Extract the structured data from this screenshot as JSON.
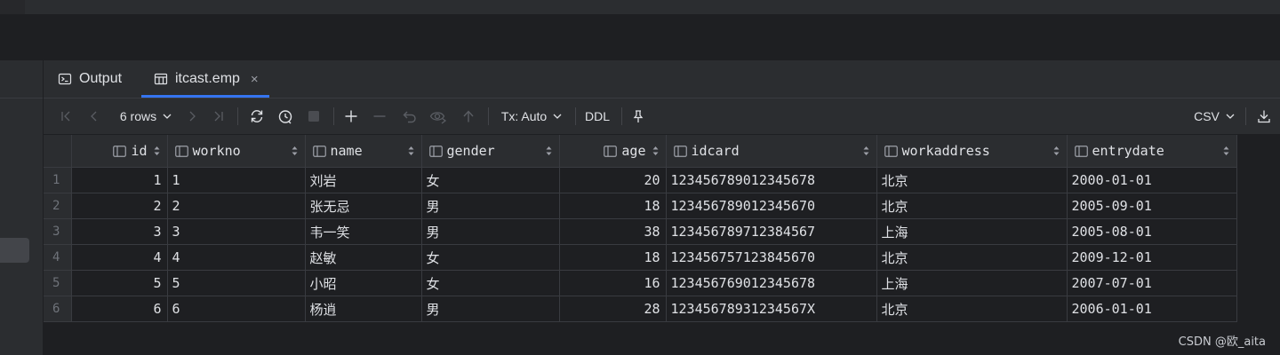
{
  "tabs": [
    {
      "label": "Output",
      "icon": "console-icon"
    },
    {
      "label": "itcast.emp",
      "icon": "table-icon",
      "close": "×"
    }
  ],
  "toolbar": {
    "rows_label": "6 rows",
    "tx_label": "Tx: Auto",
    "ddl_label": "DDL",
    "export_label": "CSV"
  },
  "grid": {
    "columns": [
      {
        "name": "id",
        "align": "right"
      },
      {
        "name": "workno",
        "align": "left"
      },
      {
        "name": "name",
        "align": "left"
      },
      {
        "name": "gender",
        "align": "left"
      },
      {
        "name": "age",
        "align": "right"
      },
      {
        "name": "idcard",
        "align": "left"
      },
      {
        "name": "workaddress",
        "align": "left"
      },
      {
        "name": "entrydate",
        "align": "left"
      }
    ],
    "rows": [
      {
        "n": "1",
        "cells": [
          "1",
          "1",
          "刘岩",
          "女",
          "20",
          "123456789012345678",
          "北京",
          "2000-01-01"
        ]
      },
      {
        "n": "2",
        "cells": [
          "2",
          "2",
          "张无忌",
          "男",
          "18",
          "123456789012345670",
          "北京",
          "2005-09-01"
        ]
      },
      {
        "n": "3",
        "cells": [
          "3",
          "3",
          "韦一笑",
          "男",
          "38",
          "123456789712384567",
          "上海",
          "2005-08-01"
        ]
      },
      {
        "n": "4",
        "cells": [
          "4",
          "4",
          "赵敏",
          "女",
          "18",
          "123456757123845670",
          "北京",
          "2009-12-01"
        ]
      },
      {
        "n": "5",
        "cells": [
          "5",
          "5",
          "小昭",
          "女",
          "16",
          "123456769012345678",
          "上海",
          "2007-07-01"
        ]
      },
      {
        "n": "6",
        "cells": [
          "6",
          "6",
          "杨逍",
          "男",
          "28",
          "12345678931234567X",
          "北京",
          "2006-01-01"
        ]
      }
    ]
  },
  "watermark": "CSDN @欧_aita",
  "colors": {
    "accent": "#3574f0",
    "bg": "#1e1f22",
    "panel": "#2b2d30"
  }
}
